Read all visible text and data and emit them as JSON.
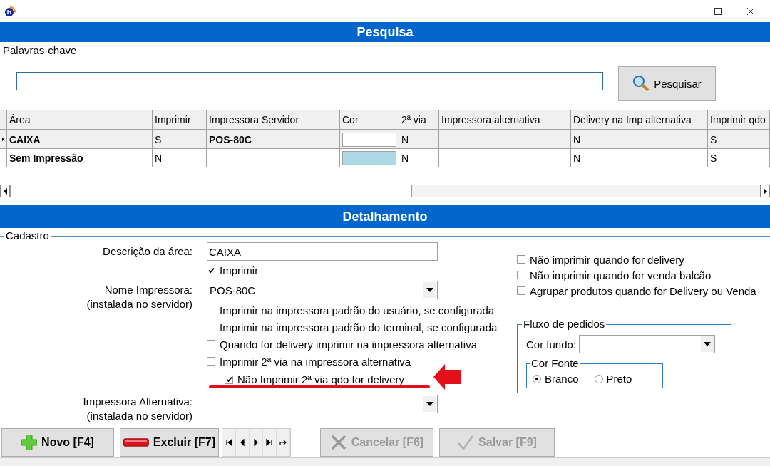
{
  "header": {
    "title": "Pesquisa"
  },
  "search": {
    "legend": "Palavras-chave",
    "button": "Pesquisar"
  },
  "table": {
    "columns": [
      "Área",
      "Imprimir",
      "Impressora Servidor",
      "Cor",
      "2ª via",
      "Impressora alternativa",
      "Delivery na Imp alternativa",
      "Imprimir qdo"
    ],
    "rows": [
      {
        "selected": true,
        "area": "CAIXA",
        "imprimir": "S",
        "impressora_servidor": "POS-80C",
        "color": "#ffffff",
        "segunda_via": "N",
        "delivery_alternativa": "N",
        "column_8": "S"
      },
      {
        "selected": false,
        "area": "Sem Impressão",
        "imprimir": "N",
        "color": "#add8e6",
        "segunda_via": "N",
        "delivery_alternativa": "N",
        "column_8": "S"
      }
    ]
  },
  "detail": {
    "title": "Detalhamento",
    "legend": "Cadastro",
    "descricao": {
      "label": "Descrição da área:",
      "value": "CAIXA"
    },
    "imprimir": {
      "label": "Imprimir",
      "checked": true
    },
    "nome_impressora": {
      "label": "Nome Impressora:",
      "sublabel": "(instalada no servidor)",
      "value": "POS-80C"
    },
    "options": [
      {
        "kind": "option",
        "label": "Imprimir na impressora padrão do usuário, se configurada",
        "checked": false
      },
      {
        "kind": "option",
        "label": "Imprimir na impressora padrão do terminal, se configurada",
        "checked": false
      },
      {
        "kind": "option",
        "label": "Quando for delivery imprimir na impressora alternativa",
        "checked": false
      },
      {
        "kind": "option",
        "label": "Imprimir 2ª via na impressora alternativa",
        "checked": false
      },
      {
        "kind": "sub_option",
        "label": "Não Imprimir 2ª via qdo for delivery",
        "checked": true
      }
    ],
    "impressora_alternativa": {
      "label": "Impressora Alternativa:",
      "sublabel": "(instalada no servidor)"
    },
    "right_options": [
      {
        "label": "Não imprimir quando for delivery",
        "checked": false
      },
      {
        "label": "Não imprimir quando for venda balcão",
        "checked": false
      },
      {
        "label": "Agrupar produtos quando for Delivery ou Venda",
        "checked": false
      }
    ],
    "fluxo": {
      "legend": "Fluxo de pedidos",
      "cor_fundo": "Cor fundo:",
      "cor_fonte": {
        "legend": "Cor Fonte",
        "options": [
          {
            "label": "Branco",
            "selected": true
          },
          {
            "label": "Preto",
            "selected": false
          }
        ]
      }
    }
  },
  "toolbar": {
    "left": [
      {
        "kind": "add",
        "label": "Novo [F4]",
        "disabled": false
      },
      {
        "kind": "delete",
        "label": "Excluir [F7]",
        "disabled": false
      }
    ],
    "right": [
      {
        "kind": "cancel",
        "label": "Cancelar [F6]",
        "disabled": true
      },
      {
        "kind": "save",
        "label": "Salvar [F9]",
        "disabled": true
      }
    ]
  }
}
